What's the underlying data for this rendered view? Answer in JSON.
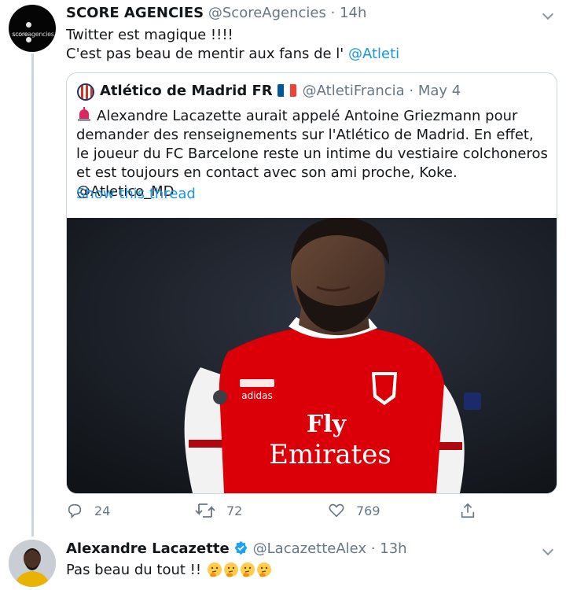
{
  "tweet1": {
    "name": "SCORE AGENCIES",
    "handle": "@ScoreAgencies",
    "time": "14h",
    "avatar_text_a": "score",
    "avatar_text_b": "agencies",
    "line1": "Twitter est magique !!!!",
    "line2_prefix": "C'est pas beau de mentir aux fans de l'",
    "mention": "@Atleti",
    "quote": {
      "name": "Atlético de Madrid FR",
      "handle": "@AtletiFrancia",
      "date": "May 4",
      "text": "Alexandre Lacazette aurait appelé Antoine Griezmann pour demander des renseignements sur l'Atlético de Madrid. En effet, le joueur du FC Barcelone reste un intime du vestiaire colchoneros et est toujours en contact avec son ami proche, Koke.",
      "mention": "@Atletico_MD",
      "show_thread": "Show this thread",
      "jersey_brand": "adidas",
      "jersey_sponsor_1": "Fly",
      "jersey_sponsor_2": "Emirates"
    },
    "actions": {
      "replies": "24",
      "retweets": "72",
      "likes": "769"
    }
  },
  "tweet2": {
    "name": "Alexandre Lacazette",
    "handle": "@LacazetteAlex",
    "time": "13h",
    "text": "Pas beau du tout !!",
    "emoji": "thinking-face",
    "emoji_count": 4
  },
  "colors": {
    "link": "#1b95e0",
    "muted": "#657786",
    "arsenal_red": "#db0007",
    "flag_blue": "#0055a4",
    "flag_red": "#ef4135"
  }
}
